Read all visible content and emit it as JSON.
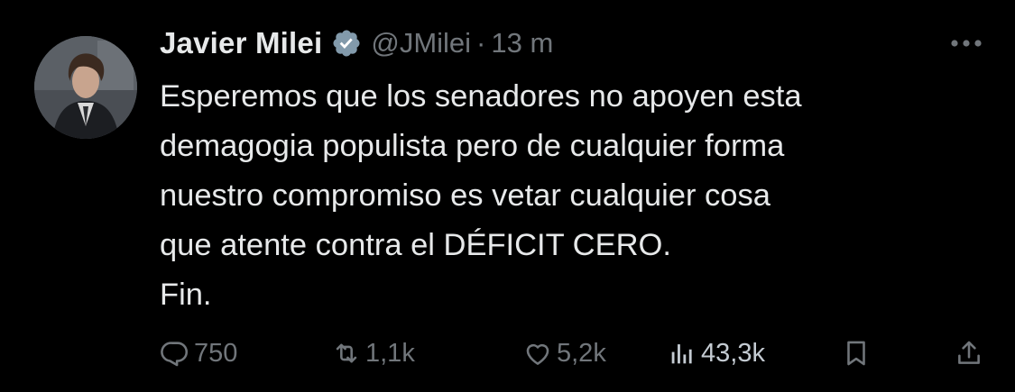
{
  "author": {
    "display_name": "Javier Milei",
    "handle": "@JMilei",
    "separator": "·",
    "timestamp": "13 m",
    "verified_color": "#829aab"
  },
  "tweet": {
    "lines": [
      "Esperemos que los senadores no apoyen esta",
      "demagogia populista pero de cualquier forma",
      "nuestro compromiso es vetar cualquier cosa",
      "que atente contra el DÉFICIT CERO.",
      "Fin."
    ]
  },
  "actions": {
    "replies": "750",
    "retweets": "1,1k",
    "likes": "5,2k",
    "views": "43,3k"
  },
  "icons": {
    "more": "more-icon",
    "reply": "reply-icon",
    "retweet": "retweet-icon",
    "like": "heart-icon",
    "views": "views-icon",
    "bookmark": "bookmark-icon",
    "share": "share-icon"
  },
  "colors": {
    "background": "#000000",
    "text": "#e7e9ea",
    "muted": "#71767b"
  }
}
